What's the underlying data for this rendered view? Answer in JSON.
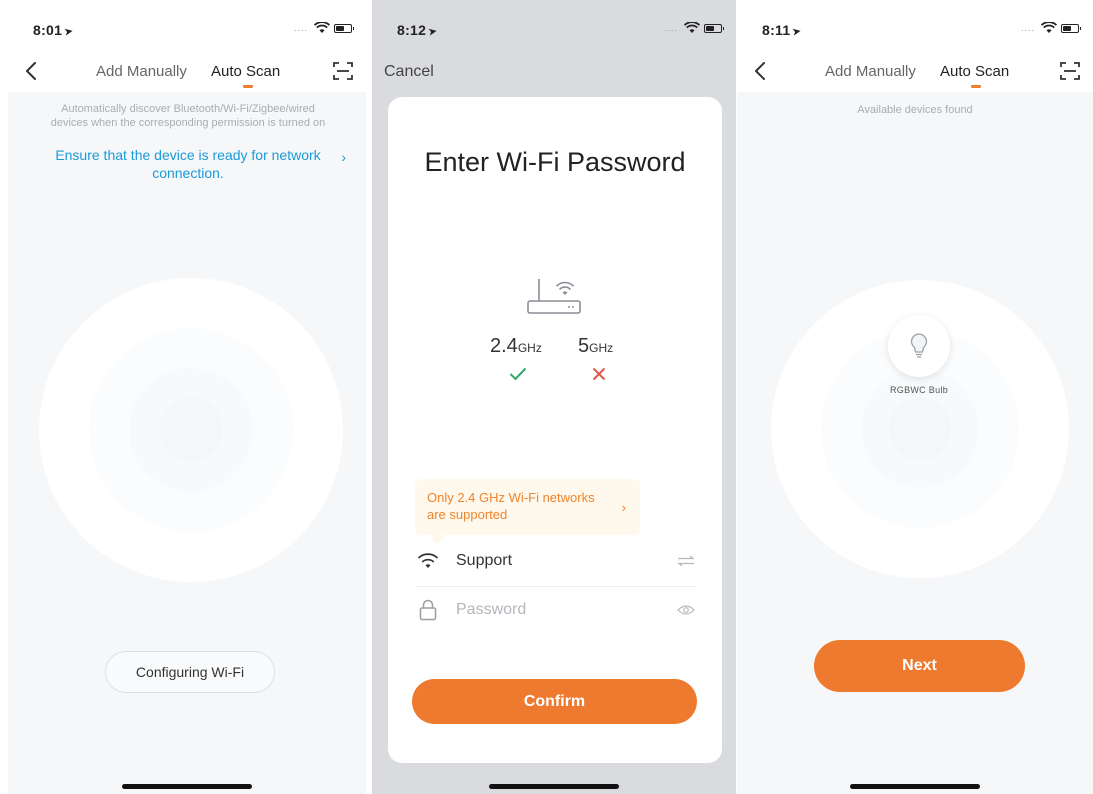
{
  "screen1": {
    "time": "8:01",
    "tabs": {
      "manual": "Add Manually",
      "auto": "Auto Scan"
    },
    "hint_line1": "Automatically discover Bluetooth/Wi-Fi/Zigbee/wired",
    "hint_line2": "devices when the corresponding permission is turned on",
    "ensure_line1": "Ensure that the device is ready for network",
    "ensure_line2": "connection.",
    "ensure_chevron": "›",
    "configuring_button": "Configuring Wi-Fi"
  },
  "screen2": {
    "time": "8:12",
    "cancel": "Cancel",
    "title": "Enter Wi-Fi Password",
    "band_24": "2.4",
    "band_5": "5",
    "band_unit": "GHz",
    "notice_line1": "Only 2.4 GHz Wi-Fi networks",
    "notice_line2": "are supported",
    "notice_chevron": "›",
    "ssid_value": "Support",
    "password_placeholder": "Password",
    "confirm_button": "Confirm"
  },
  "screen3": {
    "time": "8:11",
    "tabs": {
      "manual": "Add Manually",
      "auto": "Auto Scan"
    },
    "hint": "Available devices found",
    "device_name": "RGBWC Bulb",
    "next_button": "Next"
  },
  "status_arrow": "➤",
  "status_dots": "....",
  "colors": {
    "accent": "#ee7a2f",
    "link": "#1a9ad6",
    "check": "#2ea866",
    "cross": "#e2574c"
  },
  "icons": [
    "back-chevron-icon",
    "scan-qr-icon",
    "router-wifi-icon",
    "check-icon",
    "cross-icon",
    "wifi-icon",
    "switch-network-icon",
    "lock-icon",
    "eye-icon",
    "bulb-icon"
  ]
}
